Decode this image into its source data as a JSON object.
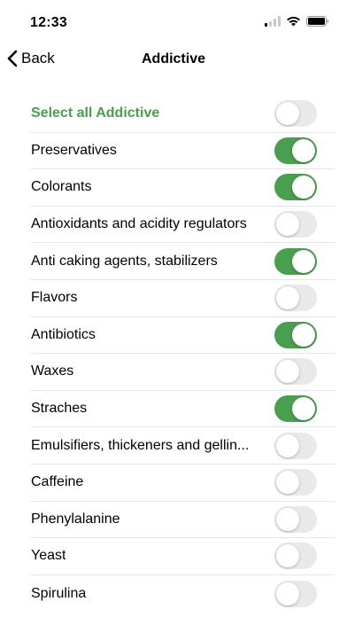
{
  "status_bar": {
    "time": "12:33",
    "icons": [
      "signal-icon",
      "wifi-icon",
      "battery-icon"
    ]
  },
  "nav": {
    "back_label": "Back",
    "title": "Addictive"
  },
  "colors": {
    "accent": "#4a9e4f",
    "toggle_off": "#e9e9eb"
  },
  "items": [
    {
      "label": "Select all Addictive",
      "on": false,
      "accent": true
    },
    {
      "label": "Preservatives",
      "on": true
    },
    {
      "label": "Colorants",
      "on": true
    },
    {
      "label": "Antioxidants and acidity regulators",
      "on": false
    },
    {
      "label": "Anti caking agents, stabilizers",
      "on": true
    },
    {
      "label": "Flavors",
      "on": false
    },
    {
      "label": "Antibiotics",
      "on": true
    },
    {
      "label": "Waxes",
      "on": false
    },
    {
      "label": "Straches",
      "on": true
    },
    {
      "label": "Emulsifiers, thickeners and gellin...",
      "on": false
    },
    {
      "label": "Caffeine",
      "on": false
    },
    {
      "label": "Phenylalanine",
      "on": false
    },
    {
      "label": "Yeast",
      "on": false
    },
    {
      "label": "Spirulina",
      "on": false
    }
  ]
}
